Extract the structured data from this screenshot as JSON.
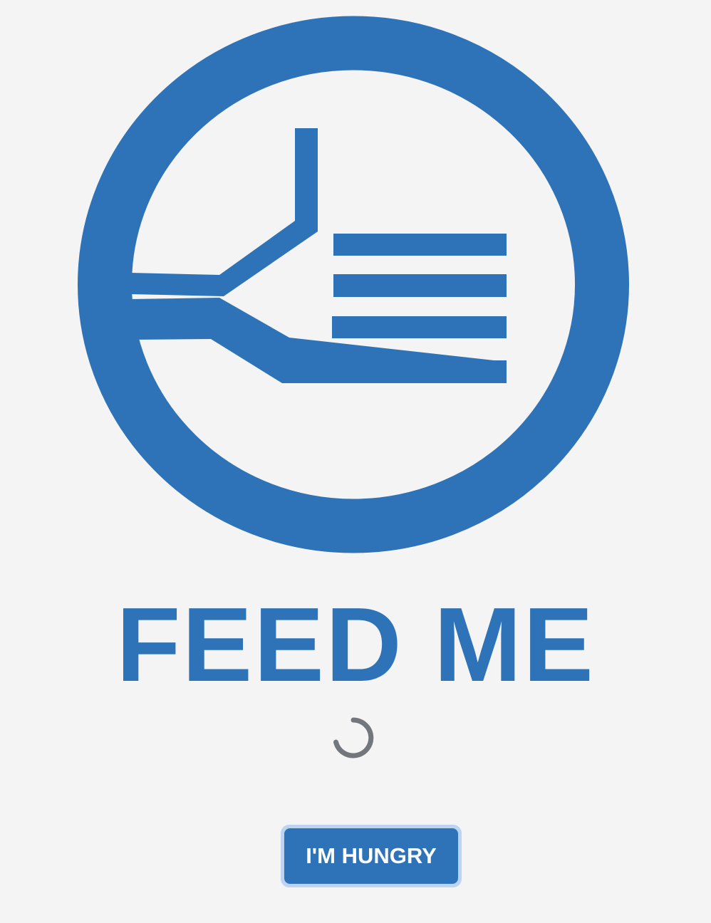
{
  "brand": {
    "title": "FEED ME",
    "logo_icon": "fork-in-circle-icon",
    "color": "#2e73b8"
  },
  "status": {
    "loading_icon": "loading-spinner-icon",
    "spinner_color": "#72777d"
  },
  "actions": {
    "hungry_label": "I'M HUNGRY"
  }
}
